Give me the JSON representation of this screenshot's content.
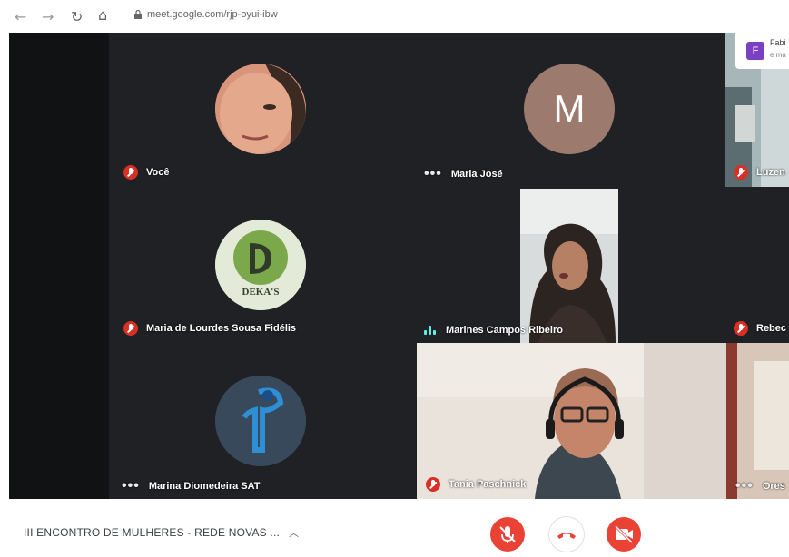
{
  "browser": {
    "url": "meet.google.com/rjp-oyui-ibw"
  },
  "participants": [
    {
      "name": "Você",
      "status": "muted"
    },
    {
      "name": "Maria José",
      "status": "idle",
      "initial": "M"
    },
    {
      "name": "Luzen",
      "status": "muted"
    },
    {
      "name": "Maria de Lourdes Sousa Fidélis",
      "status": "muted",
      "logo_text": "DEKA'S"
    },
    {
      "name": "Marines Campos Ribeiro",
      "status": "speaking"
    },
    {
      "name": "Rebec",
      "status": "muted"
    },
    {
      "name": "Marina Diomedeira SAT",
      "status": "idle"
    },
    {
      "name": "Tania Paschnick",
      "status": "muted"
    },
    {
      "name": "Ores",
      "status": "idle"
    }
  ],
  "chat_notice": {
    "initial": "F",
    "name": "Fabi",
    "snippet": "e ma"
  },
  "bottom_bar": {
    "meeting_title": "III ENCONTRO DE MULHERES - REDE NOVAS ...",
    "mic_button_color": "#ea4335",
    "end_call_color": "#ea4335",
    "camera_button_color": "#ea4335"
  }
}
